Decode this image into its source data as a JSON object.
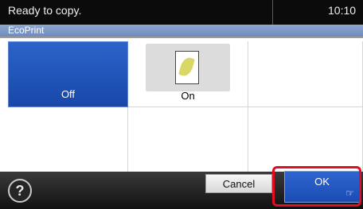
{
  "status": {
    "message": "Ready to copy.",
    "time": "10:10"
  },
  "header": {
    "title": "EcoPrint"
  },
  "options": [
    {
      "label": "Off",
      "selected": true
    },
    {
      "label": "On",
      "selected": false,
      "icon": "eco-leaf-document-icon"
    }
  ],
  "footer": {
    "help_icon": "help-icon",
    "cancel_label": "Cancel",
    "ok_label": "OK"
  },
  "colors": {
    "selected_button": "#1f4fb1",
    "title_bar": "#7f99c9",
    "highlight": "#e10e1f"
  }
}
